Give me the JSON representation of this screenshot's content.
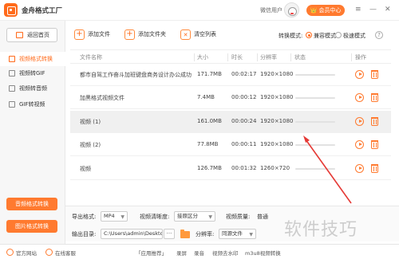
{
  "app": {
    "title": "金舟格式工厂",
    "user_label": "微信用户",
    "vip_label": "会员中心",
    "window_controls": [
      "≡",
      "—",
      "✕"
    ]
  },
  "sidebar": {
    "back_label": "返回首页",
    "items": [
      {
        "label": "视频格式转换",
        "active": true
      },
      {
        "label": "视频转GIF",
        "active": false
      },
      {
        "label": "视频转音频",
        "active": false
      },
      {
        "label": "GIF转视频",
        "active": false
      }
    ],
    "promo_buttons": [
      "音频格式转换",
      "图片格式转换"
    ]
  },
  "toolbar": {
    "add_file": "添加文件",
    "add_folder": "添加文件夹",
    "clear_list": "清空列表",
    "mode_label": "转换模式:",
    "mode_options": [
      {
        "label": "兼容模式",
        "selected": true
      },
      {
        "label": "极速模式",
        "selected": false
      }
    ],
    "help": "?"
  },
  "table": {
    "headers": {
      "name": "文件名称",
      "size": "大小",
      "duration": "时长",
      "resolution": "分辨率",
      "status": "状态",
      "action": "操作"
    },
    "rows": [
      {
        "name": "都市自驾工作奋斗加班键盘商务设计办公成功",
        "size": "171.7MB",
        "duration": "00:02:17",
        "resolution": "1920×1080",
        "selected": false
      },
      {
        "name": "加黑格式视频文件",
        "size": "7.4MB",
        "duration": "00:00:12",
        "resolution": "1920×1080",
        "selected": false
      },
      {
        "name": "视频 (1)",
        "size": "161.0MB",
        "duration": "00:00:24",
        "resolution": "1920×1080",
        "selected": true
      },
      {
        "name": "视频 (2)",
        "size": "77.8MB",
        "duration": "00:00:11",
        "resolution": "1920×1080",
        "selected": false
      },
      {
        "name": "视频",
        "size": "126.7MB",
        "duration": "00:01:32",
        "resolution": "1260×720",
        "selected": false
      }
    ]
  },
  "bottom": {
    "export_format_label": "导出格式:",
    "export_format_value": "MP4",
    "video_clarity_label": "视频清晰度:",
    "video_clarity_value": "接原区分",
    "video_quality_label": "视频质量:",
    "video_quality_value": "普通",
    "output_dir_label": "输出目录:",
    "output_dir_value": "C:\\Users\\admin\\Desktop\\",
    "more_label": "···",
    "resolution_label": "分辨率:",
    "resolution_value": "同源文件",
    "caret": "▼"
  },
  "statusbar": {
    "website": "官方网站",
    "support": "在线客服",
    "items": [
      "「应用推荐」",
      "录屏",
      "录音",
      "视频去水印",
      "m3u8视频转换"
    ]
  },
  "overlay": {
    "watermark": "软件技巧",
    "arrow_color": "#e53935"
  }
}
